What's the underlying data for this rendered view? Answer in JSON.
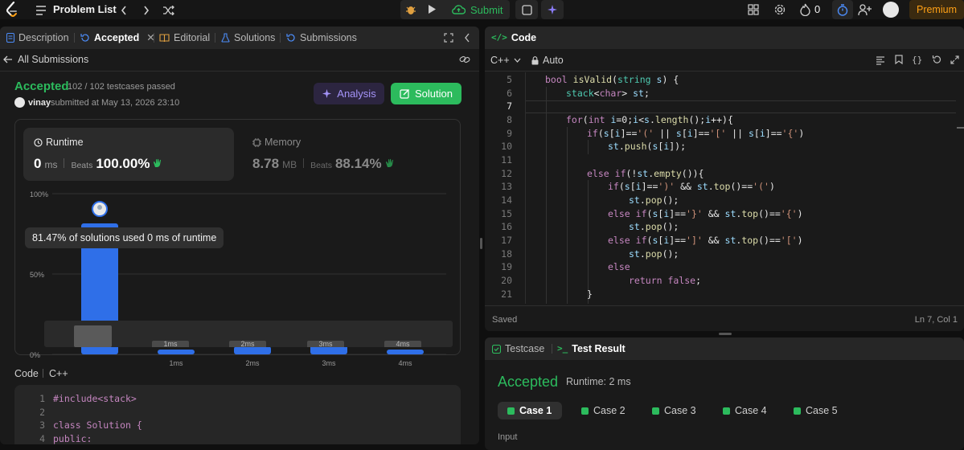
{
  "topbar": {
    "title": "Problem List",
    "submit_label": "Submit",
    "streak_count": "0",
    "premium_label": "Premium"
  },
  "left_tabs": {
    "description": "Description",
    "accepted": "Accepted",
    "editorial": "Editorial",
    "solutions": "Solutions",
    "submissions": "Submissions"
  },
  "submission": {
    "back_label": "All Submissions",
    "status": "Accepted",
    "testcases": "102 / 102 testcases passed",
    "username": "vinay",
    "submitted_text": "submitted at May 13, 2026 23:10",
    "analysis_label": "Analysis",
    "solution_label": "Solution"
  },
  "runtime": {
    "label": "Runtime",
    "value": "0",
    "unit": "ms",
    "beats_label": "Beats",
    "beats_value": "100.00%"
  },
  "memory": {
    "label": "Memory",
    "value": "8.78",
    "unit": "MB",
    "beats_label": "Beats",
    "beats_value": "88.14%"
  },
  "chart_data": {
    "type": "bar",
    "categories": [
      "0ms",
      "1ms",
      "2ms",
      "3ms",
      "4ms"
    ],
    "values": [
      81.47,
      3,
      5,
      7,
      3
    ],
    "ylim": [
      0,
      100
    ],
    "y_ticks": [
      "100%",
      "50%",
      "0%"
    ],
    "x_tick_labels": [
      "",
      "1ms",
      "2ms",
      "3ms",
      "4ms"
    ],
    "tooltip": "81.47% of solutions used 0 ms of runtime",
    "grid": true
  },
  "minimap_labels": [
    "1ms",
    "2ms",
    "3ms",
    "4ms"
  ],
  "left_code": {
    "label": "Code",
    "lang": "C++",
    "lines": [
      {
        "n": "1",
        "text": "#include<stack>"
      },
      {
        "n": "2",
        "text": ""
      },
      {
        "n": "3",
        "text": "class Solution {"
      },
      {
        "n": "4",
        "text": "public:"
      }
    ]
  },
  "editor": {
    "title": "Code",
    "lang": "C++",
    "mode": "Auto",
    "status_saved": "Saved",
    "cursor": "Ln 7, Col 1",
    "line_numbers": [
      "5",
      "6",
      "7",
      "8",
      "9",
      "10",
      "11",
      "12",
      "13",
      "14",
      "15",
      "16",
      "17",
      "18",
      "19",
      "20",
      "21"
    ]
  },
  "result": {
    "tab_testcase": "Testcase",
    "tab_result": "Test Result",
    "status": "Accepted",
    "runtime": "Runtime: 2 ms",
    "cases": [
      "Case 1",
      "Case 2",
      "Case 3",
      "Case 4",
      "Case 5"
    ],
    "input_label": "Input"
  },
  "colors": {
    "accent_green": "#2cbb5d",
    "bar_blue": "#2f6fe8",
    "premium_orange": "#ffa116"
  }
}
